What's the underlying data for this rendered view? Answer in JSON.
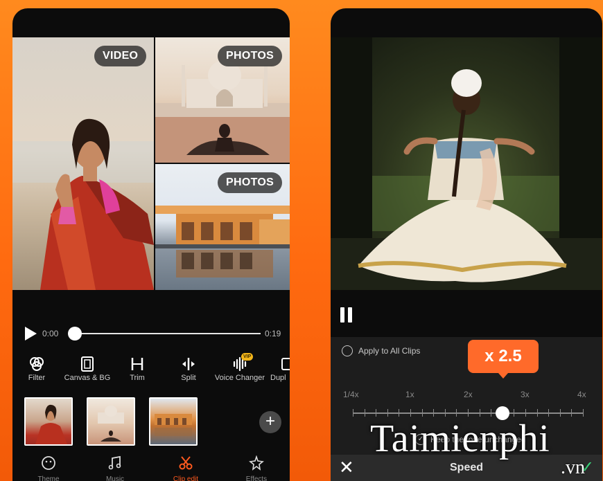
{
  "left_screen": {
    "tiles": {
      "video_label": "VIDEO",
      "photos_label_1": "PHOTOS",
      "photos_label_2": "PHOTOS"
    },
    "player": {
      "time_start": "0:00",
      "time_end": "0:19",
      "progress": 0.0
    },
    "tools": [
      {
        "label": "Filter",
        "icon": "filter-icon"
      },
      {
        "label": "Canvas & BG",
        "icon": "canvas-icon"
      },
      {
        "label": "Trim",
        "icon": "trim-icon"
      },
      {
        "label": "Split",
        "icon": "split-icon"
      },
      {
        "label": "Voice Changer",
        "icon": "voice-changer-icon",
        "badge": "VIP"
      },
      {
        "label": "Dupl",
        "icon": "duplicate-icon"
      }
    ],
    "bottom_nav": [
      {
        "label": "Theme",
        "icon": "theme-icon"
      },
      {
        "label": "Music",
        "icon": "music-icon"
      },
      {
        "label": "Clip edit",
        "icon": "scissors-icon",
        "active": true
      },
      {
        "label": "Effects",
        "icon": "effects-icon"
      }
    ],
    "accent_color": "#ff5a1f"
  },
  "right_screen": {
    "apply_all_label": "Apply to All Clips",
    "speed_value": "x 2.5",
    "speed_ticks": [
      "1/4x",
      "1x",
      "2x",
      "3x",
      "4x"
    ],
    "keep_tone_label": "Keep the tone unchanged",
    "title": "Speed",
    "close_icon": "✕",
    "confirm_icon": "✓",
    "bubble_color": "#ff6a2a"
  },
  "watermark": {
    "text": "Taimienphi",
    "suffix": ".vn"
  }
}
